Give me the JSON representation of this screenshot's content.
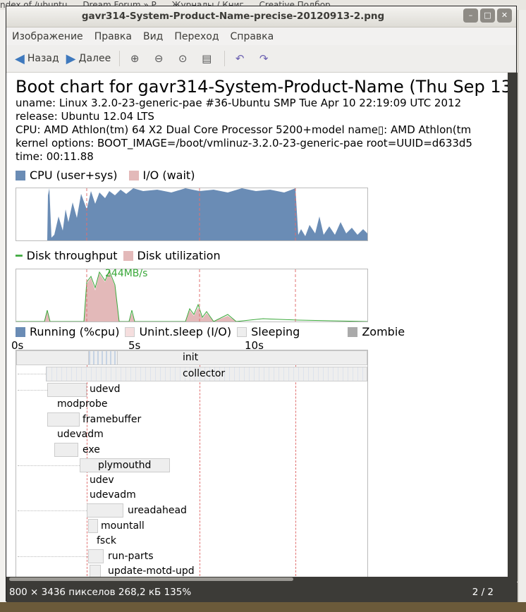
{
  "background": {
    "tabs": [
      "ndex of /ubuntu",
      "Dream Forum » P",
      "Журналы / Книг",
      "Creative Подбор"
    ]
  },
  "window": {
    "title": "gavr314-System-Product-Name-precise-20120913-2.png",
    "controls": [
      "minimize-icon",
      "maximize-icon",
      "close-icon"
    ]
  },
  "menu": [
    "Изображение",
    "Правка",
    "Вид",
    "Переход",
    "Справка"
  ],
  "toolbar": {
    "back": "Назад",
    "forward": "Далее",
    "icons": [
      "zoom-in-icon",
      "zoom-out-icon",
      "zoom-normal-icon",
      "fit-icon",
      "rotate-left-icon",
      "rotate-right-icon"
    ]
  },
  "bootchart": {
    "title": "Boot chart for gavr314-System-Product-Name (Thu Sep 13",
    "uname": "uname: Linux 3.2.0-23-generic-pae #36-Ubuntu SMP Tue Apr 10 22:19:09 UTC 2012",
    "release": "release: Ubuntu 12.04 LTS",
    "cpu": "CPU: AMD Athlon(tm) 64 X2 Dual Core Processor 5200+model name▯: AMD Athlon(tm",
    "kernel": "kernel options: BOOT_IMAGE=/boot/vmlinuz-3.2.0-23-generic-pae root=UUID=d633d5",
    "time": "time: 00:11.88",
    "cpu_legend": [
      "CPU (user+sys)",
      "I/O (wait)"
    ],
    "disk_legend": [
      "Disk throughput",
      "Disk utilization"
    ],
    "disk_peak": "244MB/s",
    "proc_legend": [
      "Running (%cpu)",
      "Unint.sleep (I/O)",
      "Sleeping",
      "Zombie"
    ],
    "time_ticks": [
      "0s",
      "5s",
      "10s"
    ],
    "processes": [
      "init",
      "collector",
      "udevd",
      "modprobe",
      "framebuffer",
      "udevadm",
      "exe",
      "plymouthd",
      "udev",
      "udevadm",
      "ureadahead",
      "mountall",
      "fsck",
      "run-parts",
      "update-motd-upd"
    ]
  },
  "status": {
    "info": "800 × 3436 пикселов  268,2 кБ   135%",
    "page": "2 / 2"
  }
}
